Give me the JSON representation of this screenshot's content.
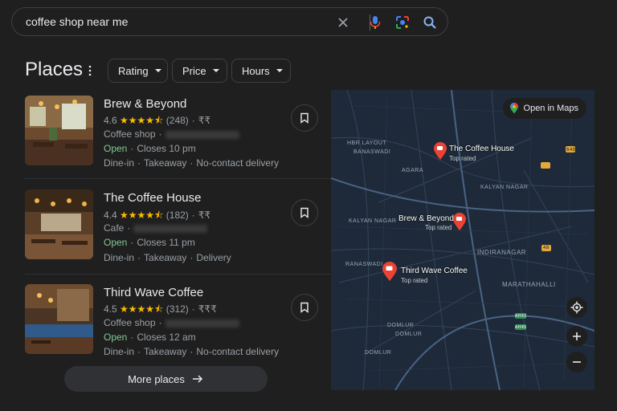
{
  "search": {
    "query": "coffee shop near me"
  },
  "header": {
    "title": "Places"
  },
  "filters": [
    "Rating",
    "Price",
    "Hours"
  ],
  "places": [
    {
      "name": "Brew & Beyond",
      "rating": "4.6",
      "stars": "★★★★⯪",
      "reviews": "(248)",
      "price": "₹₹",
      "category": "Coffee shop",
      "status": "Open",
      "closes": "Closes 10 pm",
      "services": [
        "Dine-in",
        "Takeaway",
        "No-contact delivery"
      ]
    },
    {
      "name": "The Coffee House",
      "rating": "4.4",
      "stars": "★★★★⯪",
      "reviews": "(182)",
      "price": "₹₹",
      "category": "Cafe",
      "status": "Open",
      "closes": "Closes 11 pm",
      "services": [
        "Dine-in",
        "Takeaway",
        "Delivery"
      ]
    },
    {
      "name": "Third Wave Coffee",
      "rating": "4.5",
      "stars": "★★★★⯪",
      "reviews": "(312)",
      "price": "₹₹₹",
      "category": "Coffee shop",
      "status": "Open",
      "closes": "Closes 12 am",
      "services": [
        "Dine-in",
        "Takeaway",
        "No-contact delivery"
      ]
    }
  ],
  "more_label": "More places",
  "map": {
    "open_label": "Open in Maps",
    "pins": [
      {
        "name": "The Coffee House",
        "sub": "Top rated"
      },
      {
        "name": "Brew & Beyond",
        "sub": "Top rated"
      },
      {
        "name": "Third Wave Coffee",
        "sub": "Top rated"
      }
    ],
    "labels": [
      "HBR LAYOUT",
      "BANASWADI",
      "AGARA",
      "KALYAN NAGAR",
      "KALYAN NAGAR",
      "INDIRANAGAR",
      "RANASWADI",
      "MARATHAHALLI",
      "DOMLUR",
      "DOMLUR",
      "DOMLUR"
    ],
    "roads": [
      "648",
      "48",
      "AH43",
      "AH45"
    ]
  },
  "colors": {
    "accent_open": "#81c995",
    "star": "#fbbc04",
    "pin": "#ea4335",
    "map_bg": "#1e2a39"
  }
}
